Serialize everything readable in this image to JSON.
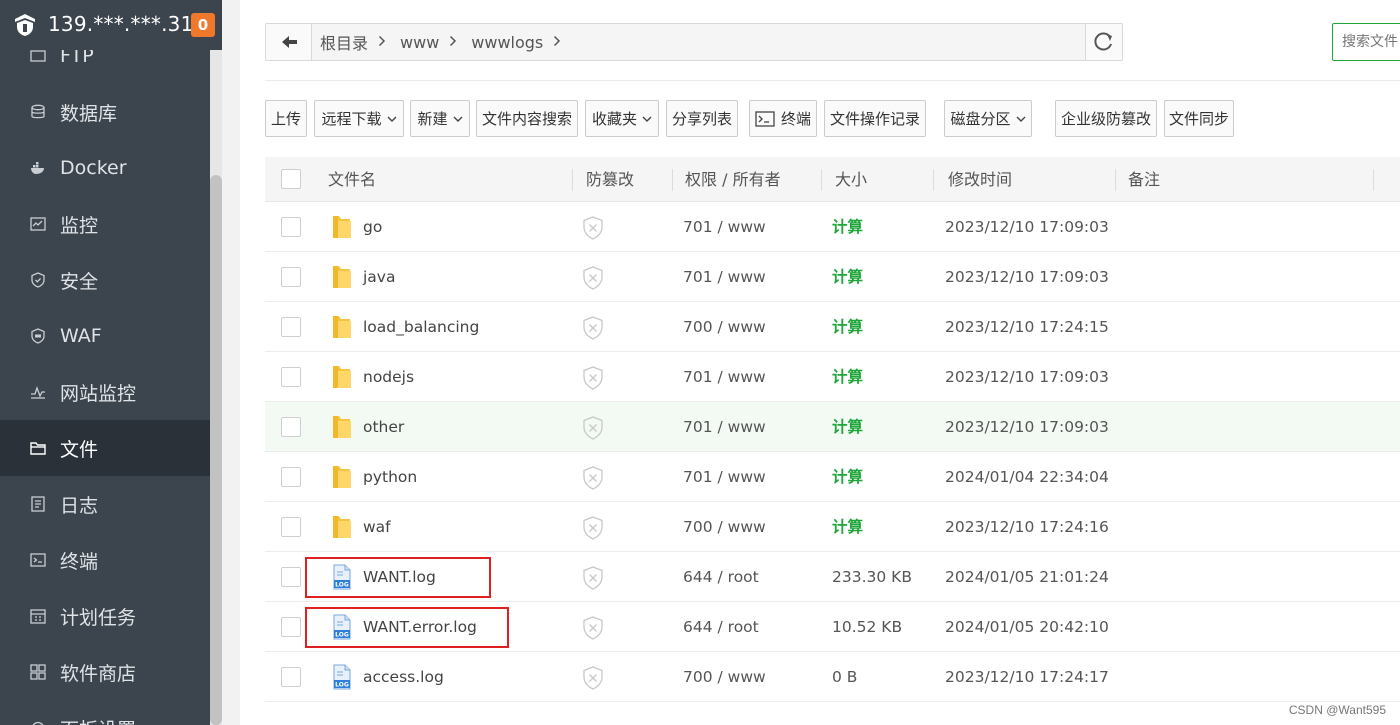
{
  "header": {
    "server_ip": "139.***.***.31",
    "badge_count": "0"
  },
  "sidebar": {
    "items": [
      {
        "label": "FTP",
        "icon": "ftp-icon"
      },
      {
        "label": "数据库",
        "icon": "database-icon"
      },
      {
        "label": "Docker",
        "icon": "docker-icon"
      },
      {
        "label": "监控",
        "icon": "monitor-icon"
      },
      {
        "label": "安全",
        "icon": "security-shield-icon"
      },
      {
        "label": "WAF",
        "icon": "waf-icon"
      },
      {
        "label": "网站监控",
        "icon": "site-monitor-icon"
      },
      {
        "label": "文件",
        "icon": "folder-icon",
        "active": true
      },
      {
        "label": "日志",
        "icon": "log-icon"
      },
      {
        "label": "终端",
        "icon": "terminal-icon"
      },
      {
        "label": "计划任务",
        "icon": "calendar-icon"
      },
      {
        "label": "软件商店",
        "icon": "app-store-icon"
      },
      {
        "label": "面板设置",
        "icon": "settings-icon"
      }
    ]
  },
  "address_bar": {
    "breadcrumbs": [
      "根目录",
      "www",
      "wwwlogs"
    ],
    "search_placeholder": "搜索文件"
  },
  "toolbar": {
    "upload": "上传",
    "remote_download": "远程下载",
    "new": "新建",
    "content_search": "文件内容搜索",
    "favorites": "收藏夹",
    "share_list": "分享列表",
    "terminal": "终端",
    "file_log": "文件操作记录",
    "disk_partition": "磁盘分区",
    "tamper_proof": "企业级防篡改",
    "file_sync": "文件同步"
  },
  "table": {
    "columns": {
      "name": "文件名",
      "tamper": "防篡改",
      "perm": "权限 / 所有者",
      "size": "大小",
      "mtime": "修改时间",
      "note": "备注"
    },
    "rows": [
      {
        "name": "go",
        "type": "folder",
        "perm": "701 / www",
        "size": "计算",
        "mtime": "2023/12/10 17:09:03"
      },
      {
        "name": "java",
        "type": "folder",
        "perm": "701 / www",
        "size": "计算",
        "mtime": "2023/12/10 17:09:03"
      },
      {
        "name": "load_balancing",
        "type": "folder",
        "perm": "700 / www",
        "size": "计算",
        "mtime": "2023/12/10 17:24:15"
      },
      {
        "name": "nodejs",
        "type": "folder",
        "perm": "701 / www",
        "size": "计算",
        "mtime": "2023/12/10 17:09:03"
      },
      {
        "name": "other",
        "type": "folder",
        "perm": "701 / www",
        "size": "计算",
        "mtime": "2023/12/10 17:09:03",
        "hover": true
      },
      {
        "name": "python",
        "type": "folder",
        "perm": "701 / www",
        "size": "计算",
        "mtime": "2024/01/04 22:34:04"
      },
      {
        "name": "waf",
        "type": "folder",
        "perm": "700 / www",
        "size": "计算",
        "mtime": "2023/12/10 17:24:16"
      },
      {
        "name": "WANT.log",
        "type": "log",
        "perm": "644 / root",
        "size": "233.30 KB",
        "mtime": "2024/01/05 21:01:24",
        "highlighted": true
      },
      {
        "name": "WANT.error.log",
        "type": "log",
        "perm": "644 / root",
        "size": "10.52 KB",
        "mtime": "2024/01/05 20:42:10",
        "highlighted": true
      },
      {
        "name": "access.log",
        "type": "log",
        "perm": "700 / www",
        "size": "0 B",
        "mtime": "2023/12/10 17:24:17"
      }
    ]
  },
  "colors": {
    "accent": "#20a53a",
    "sidebar_bg": "#3c444d",
    "highlight": "#e02020",
    "badge": "#f0782a"
  },
  "watermark": "CSDN @Want595"
}
